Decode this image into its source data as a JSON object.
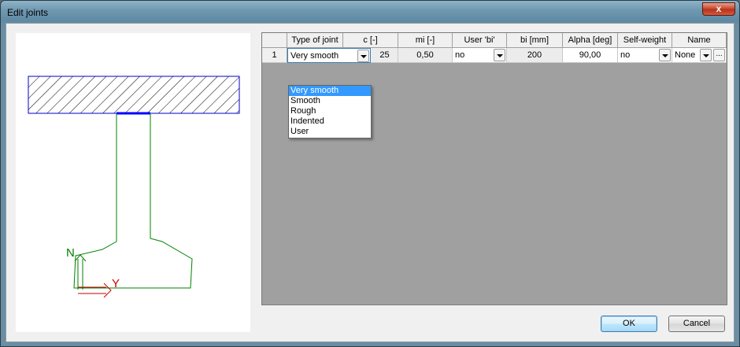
{
  "window": {
    "title": "Edit joints",
    "close_label": "x"
  },
  "preview": {
    "axis_n": "N",
    "axis_y": "Y",
    "colors": {
      "flange_outline": "#0000cc",
      "joint": "#0000ff",
      "web": "#008000",
      "axis_n": "#008000",
      "axis_y": "#cc0000"
    }
  },
  "grid": {
    "columns": [
      "",
      "Type of joint",
      "c [-]",
      "mi  [-]",
      "User 'bi'",
      "bi [mm]",
      "Alpha [deg]",
      "Self-weight",
      "Name"
    ],
    "rows": [
      {
        "index": "1",
        "type_of_joint": "Very smooth",
        "c": "25",
        "mi": "0,50",
        "user_bi": "no",
        "bi": "200",
        "alpha": "90,00",
        "self_weight": "no",
        "name": "None",
        "name_button": "..."
      }
    ]
  },
  "dropdown": {
    "options": [
      "Very smooth",
      "Smooth",
      "Rough",
      "Indented",
      "User"
    ],
    "selected": "Very smooth"
  },
  "buttons": {
    "ok": "OK",
    "cancel": "Cancel"
  }
}
